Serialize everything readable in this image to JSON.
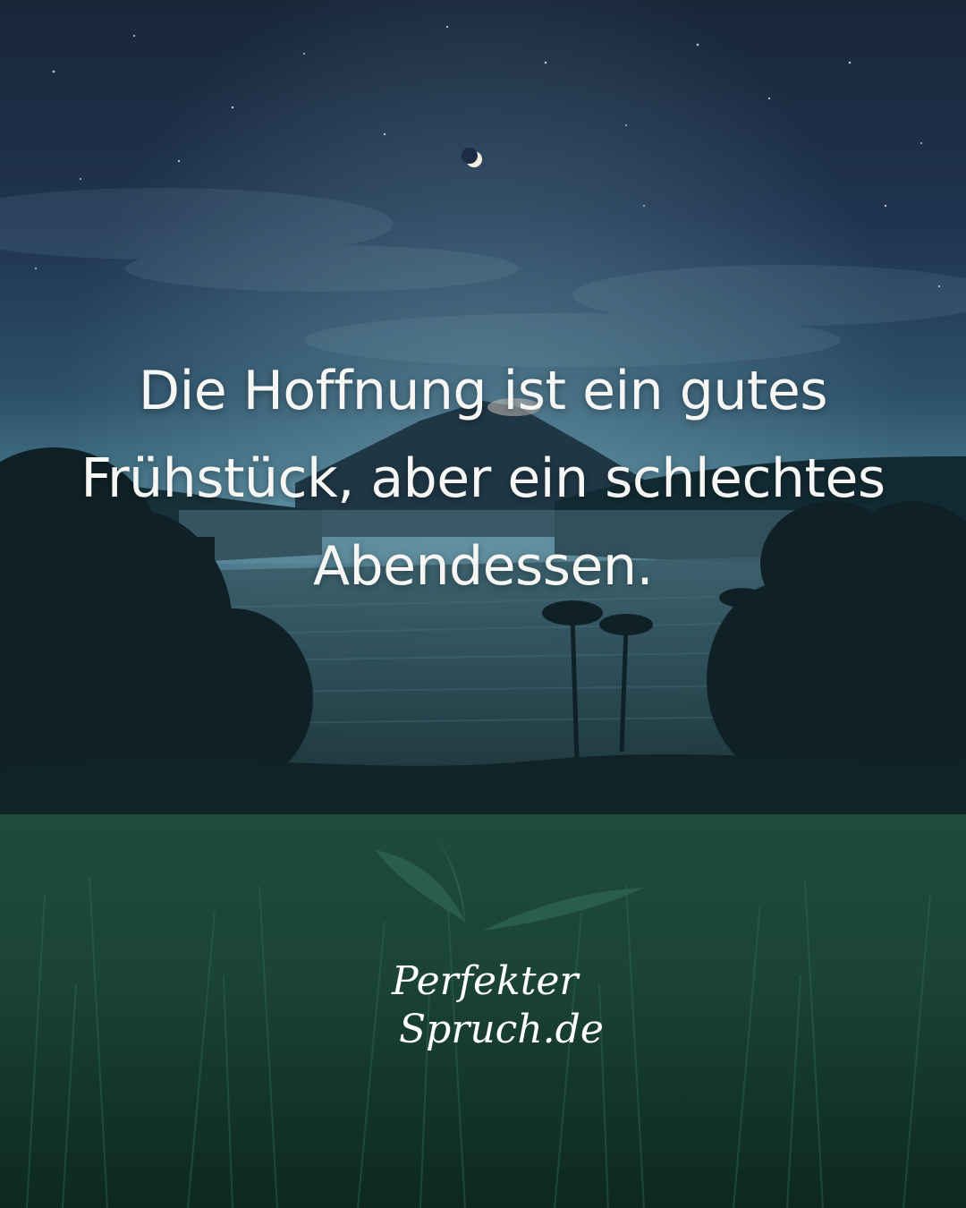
{
  "quote": {
    "lines": [
      "Die Hoffnung ist ein gutes",
      "Frühstück, aber ein schlechtes",
      "Abendessen."
    ]
  },
  "logo": {
    "line1": "Perfekter",
    "line2": "Spruch.de"
  },
  "colors": {
    "sky_top": "#1b2b44",
    "sky_mid": "#2d5468",
    "horizon_glow": "#5c8da0",
    "grass": "#1e4a3c",
    "text": "#f6f7f4"
  }
}
